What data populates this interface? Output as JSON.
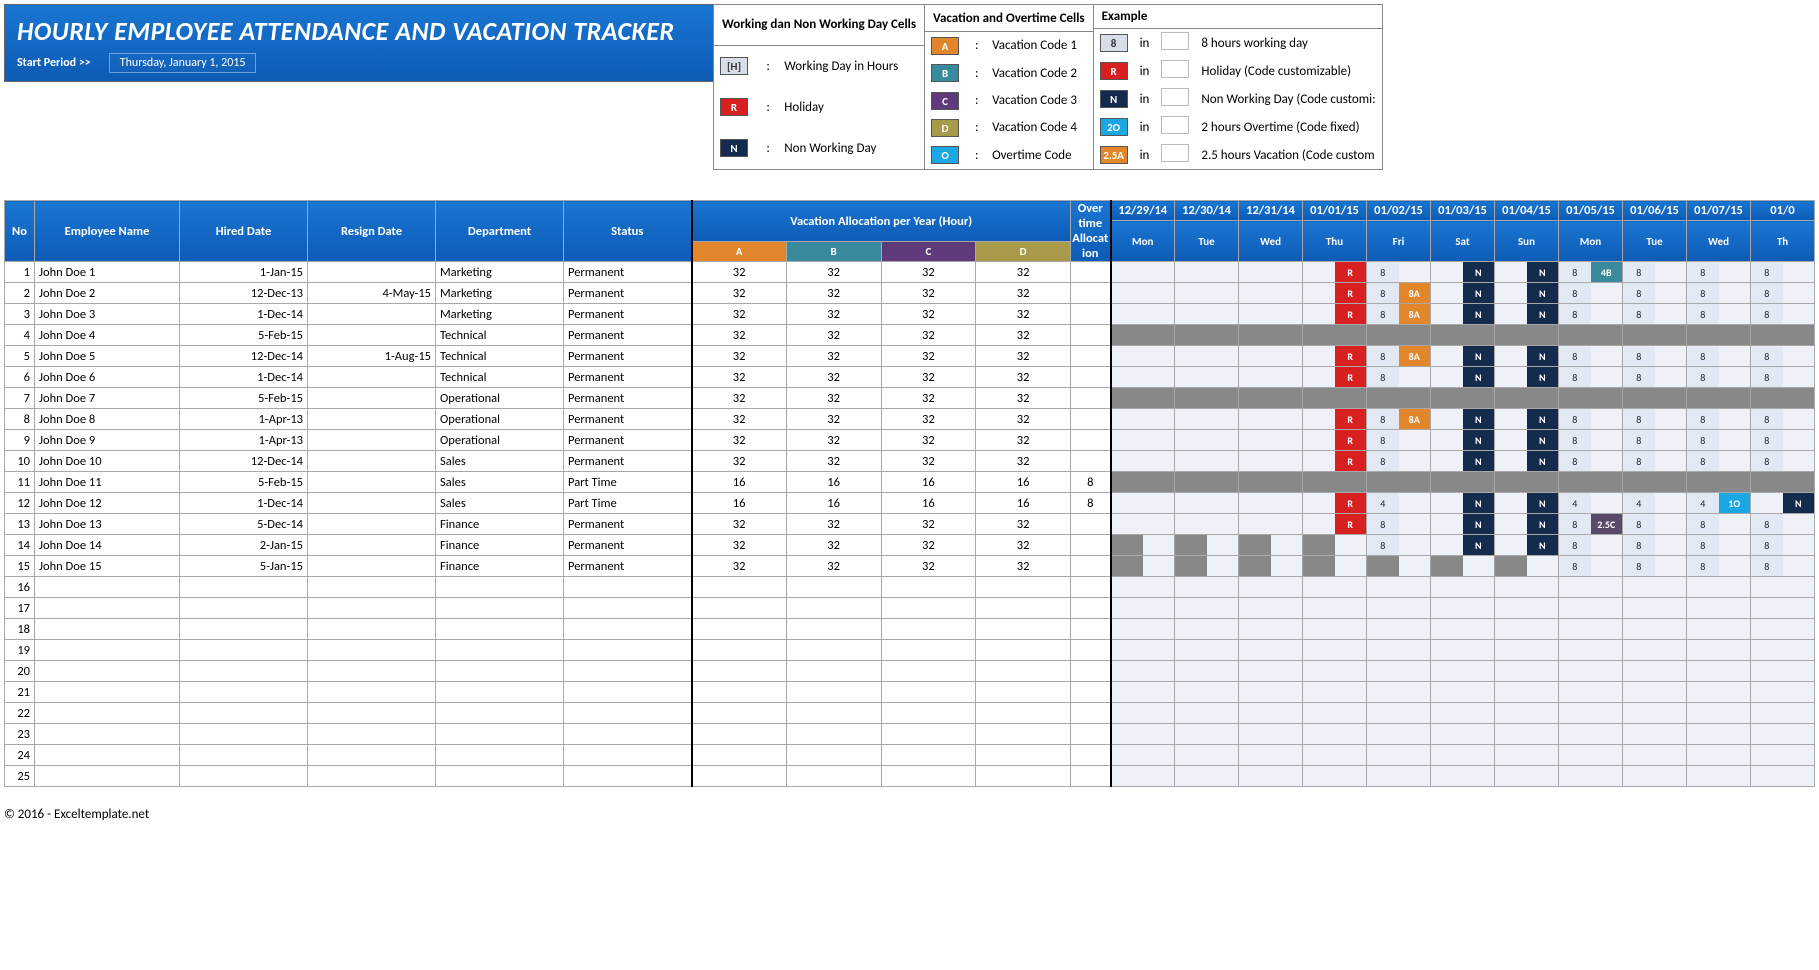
{
  "header": {
    "title": "HOURLY EMPLOYEE ATTENDANCE AND VACATION TRACKER",
    "start_period_label": "Start Period >>",
    "start_period_value": "Thursday, January 1, 2015"
  },
  "legend_working": {
    "title": "Working dan Non Working Day Cells",
    "rows": [
      {
        "chip": "[H]",
        "cls": "chip-gray",
        "label": "Working Day in Hours"
      },
      {
        "chip": "R",
        "cls": "chip-red",
        "label": "Holiday"
      },
      {
        "chip": "N",
        "cls": "chip-navy",
        "label": "Non Working Day"
      }
    ]
  },
  "legend_vacation": {
    "title": "Vacation and Overtime Cells",
    "rows": [
      {
        "chip": "A",
        "cls": "chip-orange",
        "label": "Vacation Code 1"
      },
      {
        "chip": "B",
        "cls": "chip-teal",
        "label": "Vacation Code 2"
      },
      {
        "chip": "C",
        "cls": "chip-purple",
        "label": "Vacation Code 3"
      },
      {
        "chip": "D",
        "cls": "chip-olive",
        "label": "Vacation Code 4"
      },
      {
        "chip": "O",
        "cls": "chip-cyan",
        "label": "Overtime Code"
      }
    ]
  },
  "legend_example": {
    "title": "Example",
    "rows": [
      {
        "chip": "8",
        "cls": "chip-gray",
        "label": "8 hours working day"
      },
      {
        "chip": "R",
        "cls": "chip-red",
        "label": "Holiday (Code customizable)"
      },
      {
        "chip": "N",
        "cls": "chip-navy",
        "label": "Non Working Day (Code customi:"
      },
      {
        "chip": "2O",
        "cls": "chip-cyan",
        "label": "2 hours Overtime (Code fixed)"
      },
      {
        "chip": "2.5A",
        "cls": "chip-orange",
        "label": "2.5 hours Vacation (Code custom"
      }
    ]
  },
  "table": {
    "headers": {
      "no": "No",
      "name": "Employee Name",
      "hired": "Hired Date",
      "resign": "Resign Date",
      "dept": "Department",
      "status": "Status",
      "vac": "Vacation Allocation per Year (Hour)",
      "vac_a": "A",
      "vac_b": "B",
      "vac_c": "C",
      "vac_d": "D",
      "ot": "Over time Allocat ion",
      "dates": [
        "12/29/14",
        "12/30/14",
        "12/31/14",
        "01/01/15",
        "01/02/15",
        "01/03/15",
        "01/04/15",
        "01/05/15",
        "01/06/15",
        "01/07/15",
        "01/0"
      ],
      "days": [
        "Mon",
        "Tue",
        "Wed",
        "Thu",
        "Fri",
        "Sat",
        "Sun",
        "Mon",
        "Tue",
        "Wed",
        "Th"
      ]
    },
    "rows": [
      {
        "no": 1,
        "name": "John Doe 1",
        "hired": "1-Jan-15",
        "resign": "",
        "dept": "Marketing",
        "status": "Permanent",
        "alloc": [
          32,
          32,
          32,
          32
        ],
        "ot": "",
        "days": [
          [
            "",
            ""
          ],
          [
            "",
            ""
          ],
          [
            "",
            ""
          ],
          [
            "",
            "R"
          ],
          [
            "8",
            ""
          ],
          [
            "",
            "N"
          ],
          [
            "",
            "N"
          ],
          [
            "8",
            "4B"
          ],
          [
            "8",
            ""
          ],
          [
            "8",
            ""
          ],
          [
            "8",
            ""
          ]
        ]
      },
      {
        "no": 2,
        "name": "John Doe 2",
        "hired": "12-Dec-13",
        "resign": "4-May-15",
        "dept": "Marketing",
        "status": "Permanent",
        "alloc": [
          32,
          32,
          32,
          32
        ],
        "ot": "",
        "days": [
          [
            "",
            ""
          ],
          [
            "",
            ""
          ],
          [
            "",
            ""
          ],
          [
            "",
            "R"
          ],
          [
            "8",
            "8A"
          ],
          [
            "",
            "N"
          ],
          [
            "",
            "N"
          ],
          [
            "8",
            ""
          ],
          [
            "8",
            ""
          ],
          [
            "8",
            ""
          ],
          [
            "8",
            ""
          ]
        ]
      },
      {
        "no": 3,
        "name": "John Doe 3",
        "hired": "1-Dec-14",
        "resign": "",
        "dept": "Marketing",
        "status": "Permanent",
        "alloc": [
          32,
          32,
          32,
          32
        ],
        "ot": "",
        "days": [
          [
            "",
            ""
          ],
          [
            "",
            ""
          ],
          [
            "",
            ""
          ],
          [
            "",
            "R"
          ],
          [
            "8",
            "8A"
          ],
          [
            "",
            "N"
          ],
          [
            "",
            "N"
          ],
          [
            "8",
            ""
          ],
          [
            "8",
            ""
          ],
          [
            "8",
            ""
          ],
          [
            "8",
            ""
          ]
        ]
      },
      {
        "no": 4,
        "name": "John Doe 4",
        "hired": "5-Feb-15",
        "resign": "",
        "dept": "Technical",
        "status": "Permanent",
        "alloc": [
          32,
          32,
          32,
          32
        ],
        "ot": "",
        "days": "gray"
      },
      {
        "no": 5,
        "name": "John Doe 5",
        "hired": "12-Dec-14",
        "resign": "1-Aug-15",
        "dept": "Technical",
        "status": "Permanent",
        "alloc": [
          32,
          32,
          32,
          32
        ],
        "ot": "",
        "days": [
          [
            "",
            ""
          ],
          [
            "",
            ""
          ],
          [
            "",
            ""
          ],
          [
            "",
            "R"
          ],
          [
            "8",
            "8A"
          ],
          [
            "",
            "N"
          ],
          [
            "",
            "N"
          ],
          [
            "8",
            ""
          ],
          [
            "8",
            ""
          ],
          [
            "8",
            ""
          ],
          [
            "8",
            ""
          ]
        ]
      },
      {
        "no": 6,
        "name": "John Doe 6",
        "hired": "1-Dec-14",
        "resign": "",
        "dept": "Technical",
        "status": "Permanent",
        "alloc": [
          32,
          32,
          32,
          32
        ],
        "ot": "",
        "days": [
          [
            "",
            ""
          ],
          [
            "",
            ""
          ],
          [
            "",
            ""
          ],
          [
            "",
            "R"
          ],
          [
            "8",
            ""
          ],
          [
            "",
            "N"
          ],
          [
            "",
            "N"
          ],
          [
            "8",
            ""
          ],
          [
            "8",
            ""
          ],
          [
            "8",
            ""
          ],
          [
            "8",
            ""
          ]
        ]
      },
      {
        "no": 7,
        "name": "John Doe 7",
        "hired": "5-Feb-15",
        "resign": "",
        "dept": "Operational",
        "status": "Permanent",
        "alloc": [
          32,
          32,
          32,
          32
        ],
        "ot": "",
        "days": "gray"
      },
      {
        "no": 8,
        "name": "John Doe 8",
        "hired": "1-Apr-13",
        "resign": "",
        "dept": "Operational",
        "status": "Permanent",
        "alloc": [
          32,
          32,
          32,
          32
        ],
        "ot": "",
        "days": [
          [
            "",
            ""
          ],
          [
            "",
            ""
          ],
          [
            "",
            ""
          ],
          [
            "",
            "R"
          ],
          [
            "8",
            "8A"
          ],
          [
            "",
            "N"
          ],
          [
            "",
            "N"
          ],
          [
            "8",
            ""
          ],
          [
            "8",
            ""
          ],
          [
            "8",
            ""
          ],
          [
            "8",
            ""
          ]
        ]
      },
      {
        "no": 9,
        "name": "John Doe 9",
        "hired": "1-Apr-13",
        "resign": "",
        "dept": "Operational",
        "status": "Permanent",
        "alloc": [
          32,
          32,
          32,
          32
        ],
        "ot": "",
        "days": [
          [
            "",
            ""
          ],
          [
            "",
            ""
          ],
          [
            "",
            ""
          ],
          [
            "",
            "R"
          ],
          [
            "8",
            ""
          ],
          [
            "",
            "N"
          ],
          [
            "",
            "N"
          ],
          [
            "8",
            ""
          ],
          [
            "8",
            ""
          ],
          [
            "8",
            ""
          ],
          [
            "8",
            ""
          ]
        ]
      },
      {
        "no": 10,
        "name": "John Doe 10",
        "hired": "12-Dec-14",
        "resign": "",
        "dept": "Sales",
        "status": "Permanent",
        "alloc": [
          32,
          32,
          32,
          32
        ],
        "ot": "",
        "days": [
          [
            "",
            ""
          ],
          [
            "",
            ""
          ],
          [
            "",
            ""
          ],
          [
            "",
            "R"
          ],
          [
            "8",
            ""
          ],
          [
            "",
            "N"
          ],
          [
            "",
            "N"
          ],
          [
            "8",
            ""
          ],
          [
            "8",
            ""
          ],
          [
            "8",
            ""
          ],
          [
            "8",
            ""
          ]
        ]
      },
      {
        "no": 11,
        "name": "John Doe 11",
        "hired": "5-Feb-15",
        "resign": "",
        "dept": "Sales",
        "status": "Part Time",
        "alloc": [
          16,
          16,
          16,
          16
        ],
        "ot": "8",
        "days": "gray"
      },
      {
        "no": 12,
        "name": "John Doe 12",
        "hired": "1-Dec-14",
        "resign": "",
        "dept": "Sales",
        "status": "Part Time",
        "alloc": [
          16,
          16,
          16,
          16
        ],
        "ot": "8",
        "days": [
          [
            "",
            ""
          ],
          [
            "",
            ""
          ],
          [
            "",
            ""
          ],
          [
            "",
            "R"
          ],
          [
            "4",
            ""
          ],
          [
            "",
            "N"
          ],
          [
            "",
            "N"
          ],
          [
            "4",
            ""
          ],
          [
            "4",
            ""
          ],
          [
            "4",
            "1O"
          ],
          [
            "",
            "N"
          ]
        ]
      },
      {
        "no": 13,
        "name": "John Doe 13",
        "hired": "5-Dec-14",
        "resign": "",
        "dept": "Finance",
        "status": "Permanent",
        "alloc": [
          32,
          32,
          32,
          32
        ],
        "ot": "",
        "days": [
          [
            "",
            ""
          ],
          [
            "",
            ""
          ],
          [
            "",
            ""
          ],
          [
            "",
            "R"
          ],
          [
            "8",
            ""
          ],
          [
            "",
            "N"
          ],
          [
            "",
            "N"
          ],
          [
            "8",
            "2.5C"
          ],
          [
            "8",
            ""
          ],
          [
            "8",
            ""
          ],
          [
            "8",
            ""
          ]
        ]
      },
      {
        "no": 14,
        "name": "John Doe 14",
        "hired": "2-Jan-15",
        "resign": "",
        "dept": "Finance",
        "status": "Permanent",
        "alloc": [
          32,
          32,
          32,
          32
        ],
        "ot": "",
        "days": [
          [
            "g",
            ""
          ],
          [
            "g",
            ""
          ],
          [
            "g",
            ""
          ],
          [
            "g",
            ""
          ],
          [
            "8",
            ""
          ],
          [
            "",
            "N"
          ],
          [
            "",
            "N"
          ],
          [
            "8",
            ""
          ],
          [
            "8",
            ""
          ],
          [
            "8",
            ""
          ],
          [
            "8",
            ""
          ]
        ]
      },
      {
        "no": 15,
        "name": "John Doe 15",
        "hired": "5-Jan-15",
        "resign": "",
        "dept": "Finance",
        "status": "Permanent",
        "alloc": [
          32,
          32,
          32,
          32
        ],
        "ot": "",
        "days": [
          [
            "g",
            ""
          ],
          [
            "g",
            ""
          ],
          [
            "g",
            ""
          ],
          [
            "g",
            ""
          ],
          [
            "g",
            ""
          ],
          [
            "g",
            ""
          ],
          [
            "g",
            ""
          ],
          [
            "8",
            ""
          ],
          [
            "8",
            ""
          ],
          [
            "8",
            ""
          ],
          [
            "8",
            ""
          ]
        ]
      }
    ],
    "empty_rows": [
      16,
      17,
      18,
      19,
      20,
      21,
      22,
      23,
      24,
      25
    ]
  },
  "footer": "© 2016 - Exceltemplate.net"
}
